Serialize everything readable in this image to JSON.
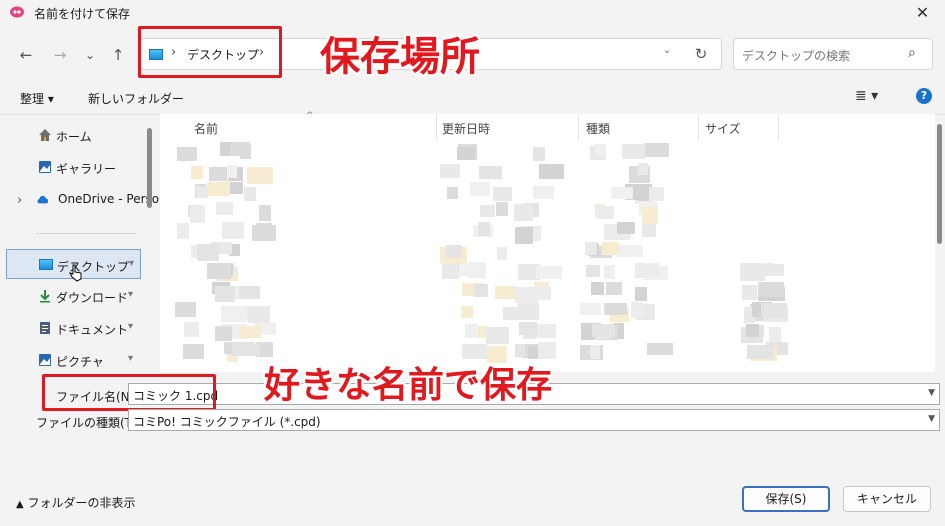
{
  "window": {
    "title": "名前を付けて保存",
    "close_label": "✕"
  },
  "nav": {
    "back": "←",
    "forward": "→",
    "recent": "⌄",
    "up": "↑"
  },
  "address": {
    "separator": "›",
    "location": "デスクトップ",
    "dropdown": "⌄",
    "refresh": "↻"
  },
  "search": {
    "placeholder": "デスクトップの検索",
    "icon": "⌕"
  },
  "toolbar": {
    "organize": "整理 ▾",
    "new_folder": "新しいフォルダー",
    "view": "≣ ▾",
    "help": "?"
  },
  "sidebar": {
    "items": [
      {
        "label": "ホーム",
        "pinned": false
      },
      {
        "label": "ギャラリー",
        "pinned": false
      },
      {
        "label": "OneDrive - Perso",
        "pinned": false
      },
      {
        "label": "デスクトップ",
        "pinned": true
      },
      {
        "label": "ダウンロード",
        "pinned": true
      },
      {
        "label": "ドキュメント",
        "pinned": true
      },
      {
        "label": "ピクチャ",
        "pinned": true
      }
    ],
    "expand": "›",
    "pin": "📌"
  },
  "columns": [
    "名前",
    "更新日時",
    "種類",
    "サイズ"
  ],
  "sort_indicator": "^",
  "filename": {
    "label": "ファイル名(N):",
    "value": "コミック 1.cpd"
  },
  "filetype": {
    "label": "ファイルの種類(T):",
    "value": "コミPo! コミックファイル (*.cpd)"
  },
  "footer": {
    "hide_folders": "フォルダーの非表示",
    "save": "保存(S)",
    "cancel": "キャンセル"
  },
  "annotations": {
    "save_location": "保存場所",
    "save_any_name": "好きな名前で保存"
  },
  "colors": {
    "annotation_red": "#e0191e",
    "accent": "#1a73c8"
  }
}
